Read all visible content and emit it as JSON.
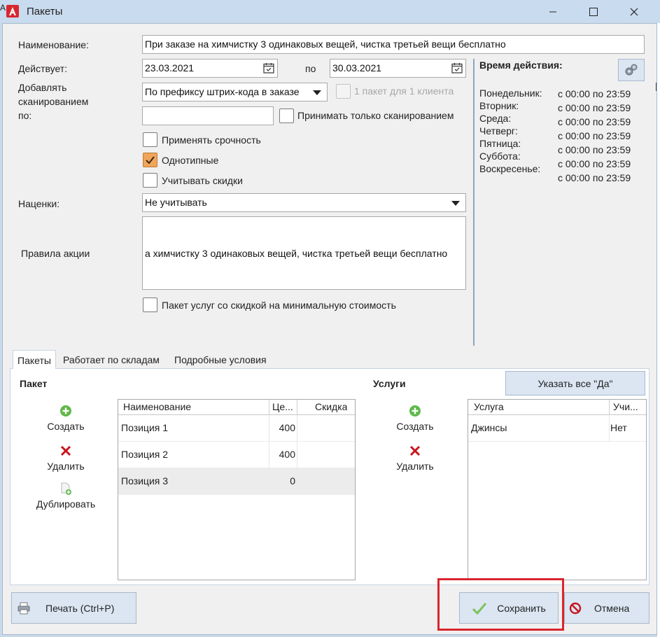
{
  "window": {
    "title": "Пакеты",
    "edge_glyph": "A"
  },
  "form": {
    "name_label": "Наименование:",
    "name_value": "При заказе на химчистку 3 одинаковых вещей, чистка третьей вещи бесплатно",
    "valid_label": "Действует:",
    "date_from": "23.03.2021",
    "to_label": "по",
    "date_to": "30.03.2021",
    "add_scan_label": "Добавлять\nсканированием\nпо:",
    "scan_mode": "По префиксу штрих-кода в заказе",
    "one_pack_label": "1 пакет для 1 клиента",
    "scan_input_value": "",
    "only_scan_label": "Принимать только сканированием",
    "urgency_label": "Применять срочность",
    "same_type_label": "Однотипные",
    "discount_label": "Учитывать скидки",
    "markup_label": "Наценки:",
    "markup_value": "Не учитывать",
    "rules_label": "Правила акции",
    "rules_text": "а химчистку 3 одинаковых вещей, чистка третьей вещи бесплатно",
    "min_cost_label": "Пакет услуг со скидкой на минимальную стоимость",
    "checks": {
      "urgency": false,
      "same_type": true,
      "discount": false,
      "only_scan": false,
      "one_pack": false,
      "min_cost": false
    }
  },
  "schedule": {
    "title": "Время действия:",
    "days": [
      "Понедельник:",
      "Вторник:",
      "Среда:",
      "Четверг:",
      "Пятница:",
      "Суббота:",
      "Воскресенье:"
    ],
    "times": [
      "с 00:00 по 23:59",
      "с 00:00 по 23:59",
      "с 00:00 по 23:59",
      "с 00:00 по 23:59",
      "с 00:00 по 23:59",
      "с 00:00 по 23:59",
      "с 00:00 по 23:59"
    ]
  },
  "tabs": [
    {
      "label": "Пакеты"
    },
    {
      "label": "Работает по складам"
    },
    {
      "label": "Подробные условия"
    }
  ],
  "packages": {
    "title": "Пакет",
    "create_label": "Создать",
    "delete_label": "Удалить",
    "duplicate_label": "Дублировать",
    "columns": [
      "Наименование",
      "Це...",
      "Скидка"
    ],
    "rows": [
      {
        "name": "Позиция 1",
        "price": "400",
        "discount": ""
      },
      {
        "name": "Позиция 2",
        "price": "400",
        "discount": ""
      },
      {
        "name": "Позиция 3",
        "price": "0",
        "discount": ""
      }
    ]
  },
  "services": {
    "title": "Услуги",
    "set_all_label": "Указать все \"Да\"",
    "create_label": "Создать",
    "delete_label": "Удалить",
    "columns": [
      "Услуга",
      "Учи..."
    ],
    "rows": [
      {
        "name": "Джинсы",
        "flag": "Нет"
      }
    ]
  },
  "footer": {
    "print_label": "Печать (Ctrl+P)",
    "save_label": "Сохранить",
    "cancel_label": "Отмена"
  },
  "colors": {
    "accent_check": "#f0a55a",
    "highlight": "#d9262e",
    "titlebar": "#c9dbee"
  }
}
